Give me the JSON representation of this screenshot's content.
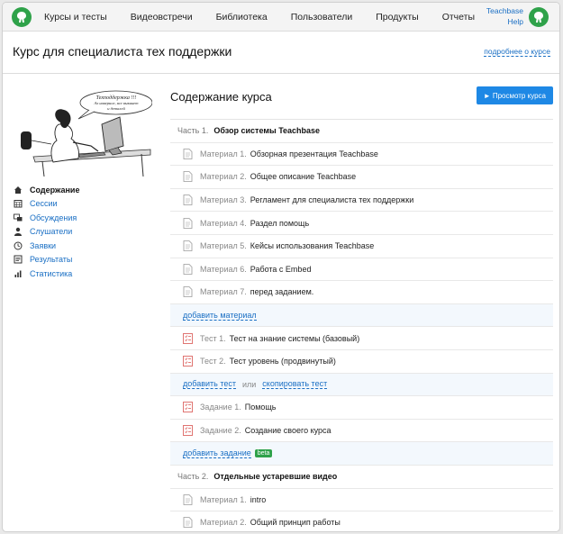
{
  "nav": {
    "items": [
      "Курсы и тесты",
      "Видеовстречи",
      "Библиотека",
      "Пользователи",
      "Продукты",
      "Отчеты"
    ],
    "help_line1": "Teachbase",
    "help_line2": "Help"
  },
  "header": {
    "title": "Курс для специалиста тех поддержки",
    "more_link": "подробнее о курсе"
  },
  "illustration": {
    "bubble_text": [
      "Техподдержка !!!",
      "Ах наверное, все выкинет",
      "и деталей"
    ]
  },
  "sidebar": {
    "items": [
      {
        "label": "Содержание",
        "icon": "home-icon",
        "active": true
      },
      {
        "label": "Сессии",
        "icon": "calendar-icon",
        "active": false
      },
      {
        "label": "Обсуждения",
        "icon": "chat-icon",
        "active": false
      },
      {
        "label": "Слушатели",
        "icon": "user-icon",
        "active": false
      },
      {
        "label": "Заявки",
        "icon": "clock-icon",
        "active": false
      },
      {
        "label": "Результаты",
        "icon": "results-icon",
        "active": false
      },
      {
        "label": "Статистика",
        "icon": "stats-icon",
        "active": false
      }
    ]
  },
  "content": {
    "title": "Содержание курса",
    "preview_button": "► Просмотр курса",
    "part1": {
      "num": "Часть 1.",
      "title": "Обзор системы Teachbase"
    },
    "materials": [
      {
        "kind": "Материал 1.",
        "name": "Обзорная презентация Teachbase"
      },
      {
        "kind": "Материал 2.",
        "name": "Общее описание Teachbase"
      },
      {
        "kind": "Материал 3.",
        "name": "Регламент для специалиста тех поддержки"
      },
      {
        "kind": "Материал 4.",
        "name": "Раздел помощь"
      },
      {
        "kind": "Материал 5.",
        "name": "Кейсы использования Teachbase"
      },
      {
        "kind": "Материал 6.",
        "name": "Работа с Embed"
      },
      {
        "kind": "Материал 7.",
        "name": "перед заданием."
      }
    ],
    "add_material": "добавить материал",
    "tests": [
      {
        "kind": "Тест 1.",
        "name": "Тест на знание системы (базовый)"
      },
      {
        "kind": "Тест 2.",
        "name": "Тест уровень (продвинутый)"
      }
    ],
    "add_test": "добавить тест",
    "or": "или",
    "copy_test": "скопировать тест",
    "tasks": [
      {
        "kind": "Задание 1.",
        "name": "Помощь"
      },
      {
        "kind": "Задание 2.",
        "name": "Создание своего курса"
      }
    ],
    "add_task": "добавить задание",
    "beta": "beta",
    "part2": {
      "num": "Часть 2.",
      "title": "Отдельные устаревшие видео"
    },
    "materials2": [
      {
        "kind": "Материал 1.",
        "name": "intro"
      },
      {
        "kind": "Материал 2.",
        "name": "Общий принцип работы"
      }
    ]
  },
  "colors": {
    "accent": "#1e88e5",
    "link": "#1a6fc4",
    "brand": "#2fa24a"
  }
}
